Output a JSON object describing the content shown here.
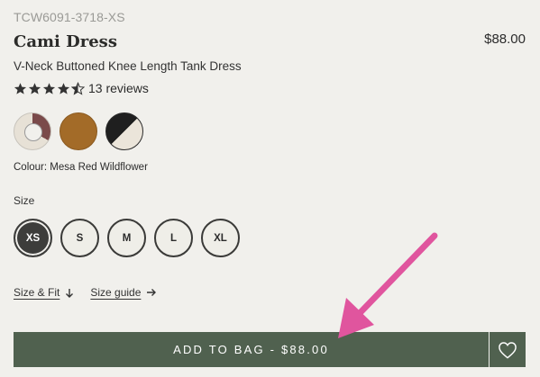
{
  "product": {
    "sku": "TCW6091-3718-XS",
    "name": "Cami Dress",
    "price": "$88.00",
    "subtitle": "V-Neck Buttoned Knee Length Tank Dress",
    "rating": 4.5,
    "reviews_label": "13 reviews"
  },
  "colours": {
    "selected_label": "Colour: Mesa Red Wildflower",
    "swatches": [
      {
        "name": "Mesa Red Wildflower",
        "colors": [
          "#7a4a4a",
          "#e7e1d6"
        ]
      },
      {
        "name": "Brown",
        "colors": [
          "#a36b28"
        ]
      },
      {
        "name": "Black / Ivory",
        "colors": [
          "#1f1f1f",
          "#ebe5da"
        ]
      }
    ]
  },
  "size": {
    "label": "Size",
    "options": [
      "XS",
      "S",
      "M",
      "L",
      "XL"
    ],
    "selected": "XS"
  },
  "links": {
    "size_fit": "Size & Fit",
    "size_guide": "Size guide"
  },
  "cta": {
    "add_to_bag": "ADD TO BAG - $88.00",
    "accent": "#50614f"
  },
  "annotation": {
    "arrow_color": "#e0559e"
  }
}
